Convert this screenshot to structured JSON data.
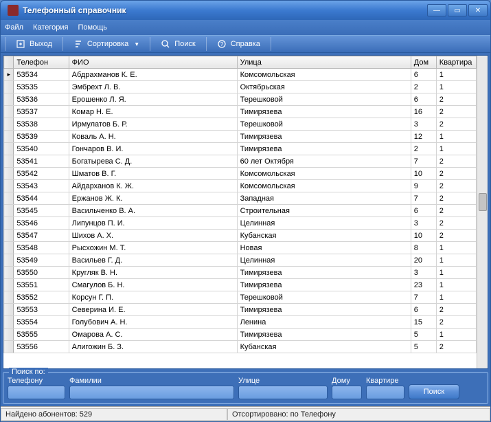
{
  "title": "Телефонный справочник",
  "menu": {
    "file": "Файл",
    "category": "Категория",
    "help": "Помощь"
  },
  "toolbar": {
    "exit": "Выход",
    "sort": "Сортировка",
    "search": "Поиск",
    "about": "Справка"
  },
  "columns": {
    "phone": "Телефон",
    "fio": "ФИО",
    "street": "Улица",
    "house": "Дом",
    "apt": "Квартира"
  },
  "rows": [
    {
      "phone": "53534",
      "fio": "Абдрахманов К. Е.",
      "street": "Комсомольская",
      "house": "6",
      "apt": "1"
    },
    {
      "phone": "53535",
      "fio": "Эмбрехт Л. В.",
      "street": "Октябрьская",
      "house": "2",
      "apt": "1"
    },
    {
      "phone": "53536",
      "fio": "Ерошенко Л. Я.",
      "street": "Терешковой",
      "house": "6",
      "apt": "2"
    },
    {
      "phone": "53537",
      "fio": "Комар Н. Е.",
      "street": "Тимирязева",
      "house": "16",
      "apt": "2"
    },
    {
      "phone": "53538",
      "fio": "Ирмулатов Б. Р.",
      "street": "Терешковой",
      "house": "3",
      "apt": "2"
    },
    {
      "phone": "53539",
      "fio": "Коваль А. Н.",
      "street": "Тимирязева",
      "house": "12",
      "apt": "1"
    },
    {
      "phone": "53540",
      "fio": "Гончаров В. И.",
      "street": "Тимирязева",
      "house": "2",
      "apt": "1"
    },
    {
      "phone": "53541",
      "fio": "Богатырева С. Д.",
      "street": "60 лет Октября",
      "house": "7",
      "apt": "2"
    },
    {
      "phone": "53542",
      "fio": "Шматов В. Г.",
      "street": "Комсомольская",
      "house": "10",
      "apt": "2"
    },
    {
      "phone": "53543",
      "fio": "Айдарханов К. Ж.",
      "street": "Комсомольская",
      "house": "9",
      "apt": "2"
    },
    {
      "phone": "53544",
      "fio": "Ержанов Ж. К.",
      "street": "Западная",
      "house": "7",
      "apt": "2"
    },
    {
      "phone": "53545",
      "fio": "Васильченко В. А.",
      "street": "Строительная",
      "house": "6",
      "apt": "2"
    },
    {
      "phone": "53546",
      "fio": "Липунцов П. И.",
      "street": "Целинная",
      "house": "3",
      "apt": "2"
    },
    {
      "phone": "53547",
      "fio": "Шихов А. Х.",
      "street": "Кубанская",
      "house": "10",
      "apt": "2"
    },
    {
      "phone": "53548",
      "fio": "Рысхожин М. Т.",
      "street": "Новая",
      "house": "8",
      "apt": "1"
    },
    {
      "phone": "53549",
      "fio": "Васильев Г. Д.",
      "street": "Целинная",
      "house": "20",
      "apt": "1"
    },
    {
      "phone": "53550",
      "fio": "Кругляк В. Н.",
      "street": "Тимирязева",
      "house": "3",
      "apt": "1"
    },
    {
      "phone": "53551",
      "fio": "Смагулов Б. Н.",
      "street": "Тимирязева",
      "house": "23",
      "apt": "1"
    },
    {
      "phone": "53552",
      "fio": "Корсун Г. П.",
      "street": "Терешковой",
      "house": "7",
      "apt": "1"
    },
    {
      "phone": "53553",
      "fio": "Северина И. Е.",
      "street": "Тимирязева",
      "house": "6",
      "apt": "2"
    },
    {
      "phone": "53554",
      "fio": "Голубович А. Н.",
      "street": "Ленина",
      "house": "15",
      "apt": "2"
    },
    {
      "phone": "53555",
      "fio": "Омарова А. С.",
      "street": "Тимирязева",
      "house": "5",
      "apt": "1"
    },
    {
      "phone": "53556",
      "fio": "Алигожин Б. З.",
      "street": "Кубанская",
      "house": "5",
      "apt": "2"
    }
  ],
  "search": {
    "group": "Поиск по:",
    "phone": "Телефону",
    "surname": "Фамилии",
    "street": "Улице",
    "house": "Дому",
    "apt": "Квартире",
    "button": "Поиск"
  },
  "status": {
    "found": "Найдено абонентов: 529",
    "sorted": "Отсортировано: по Телефону"
  }
}
